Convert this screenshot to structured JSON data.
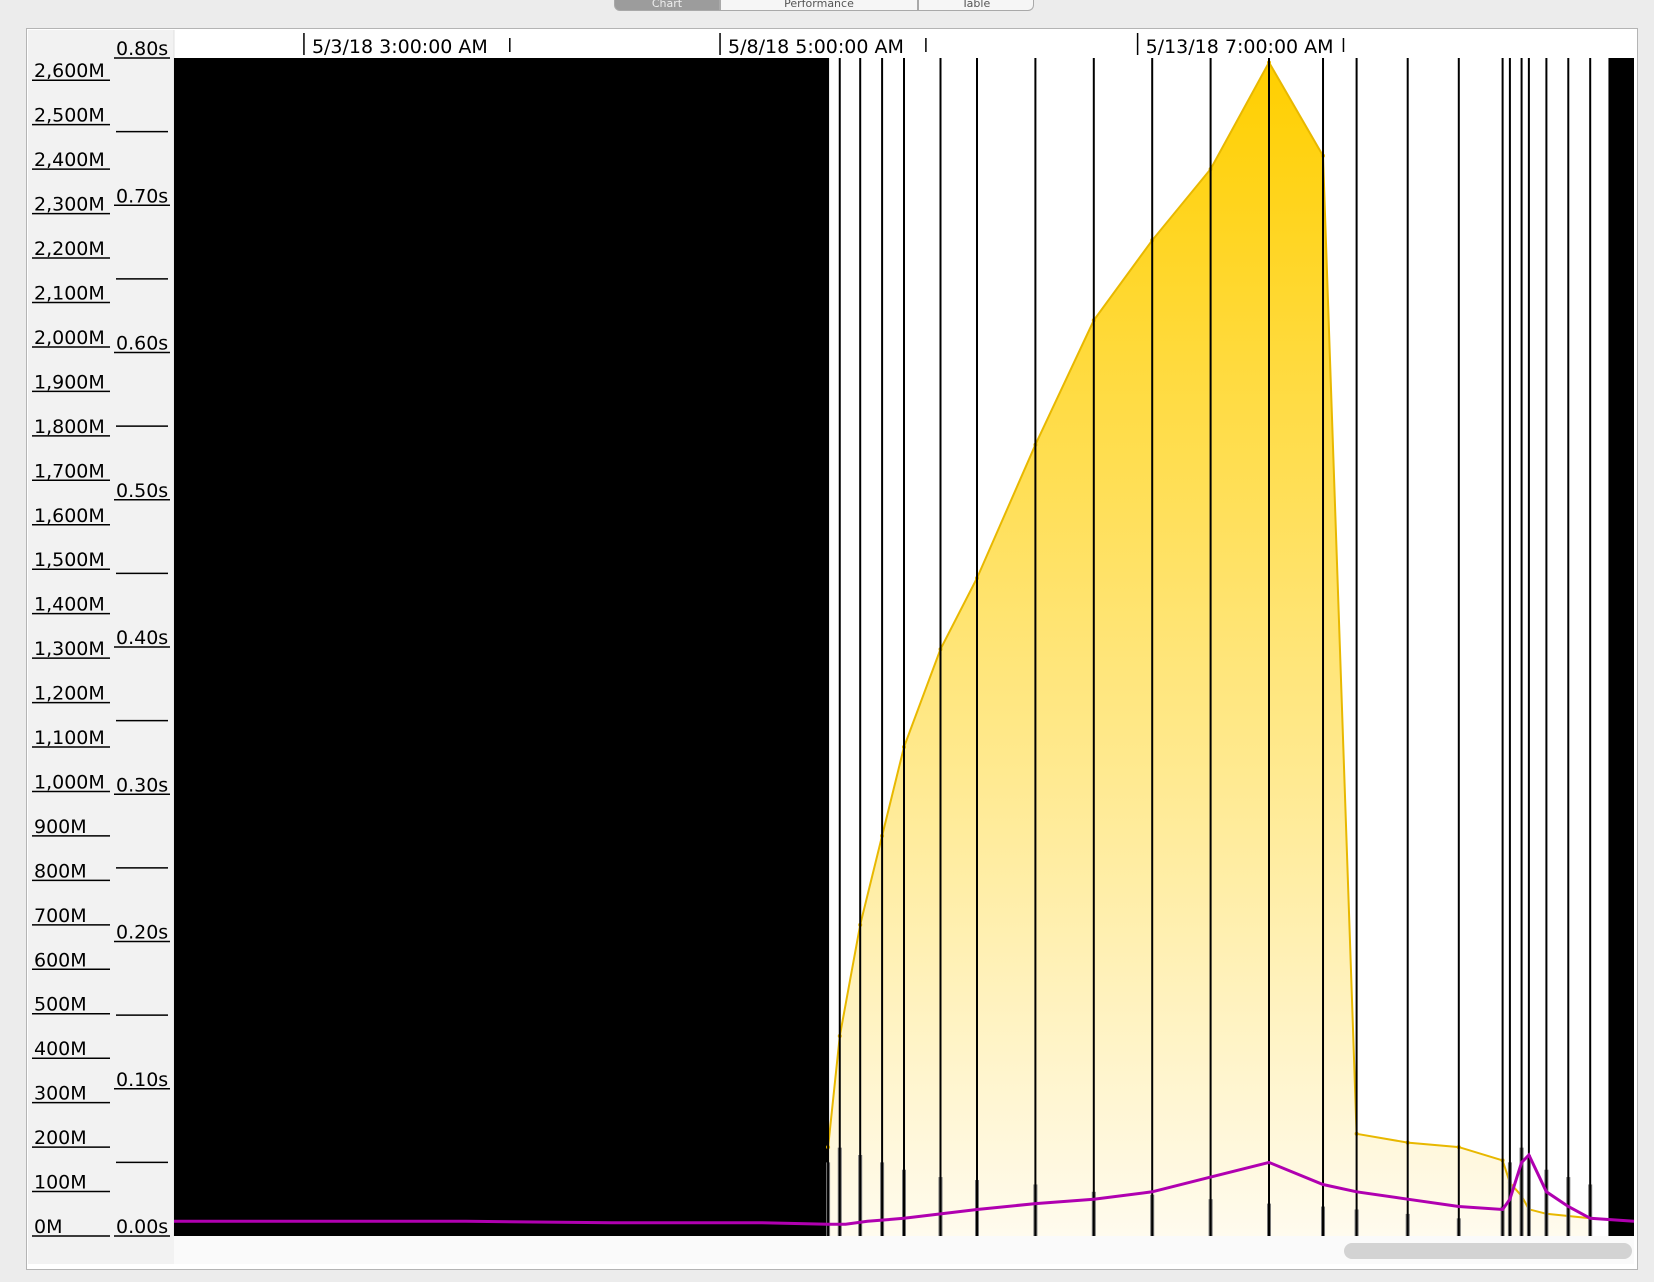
{
  "tabs": [
    {
      "label": "Chart"
    },
    {
      "label": "Performance"
    },
    {
      "label": "Table"
    }
  ],
  "chart_data": {
    "type": "area",
    "x_axis": {
      "type": "time",
      "tick_labels": [
        "5/3/18 3:00:00 AM",
        "5/8/18 5:00:00 AM",
        "5/13/18 7:00:00 AM"
      ]
    },
    "memory_axis": {
      "range": [
        0,
        2650
      ],
      "tick_labels": [
        "0M",
        "100M",
        "200M",
        "300M",
        "400M",
        "500M",
        "600M",
        "700M",
        "800M",
        "900M",
        "1,000M",
        "1,100M",
        "1,200M",
        "1,300M",
        "1,400M",
        "1,500M",
        "1,600M",
        "1,700M",
        "1,800M",
        "1,900M",
        "2,000M",
        "2,100M",
        "2,200M",
        "2,300M",
        "2,400M",
        "2,500M",
        "2,600M"
      ]
    },
    "time_axis": {
      "range": [
        0,
        0.8
      ],
      "tick_labels": [
        "0.00s",
        "0.10s",
        "0.20s",
        "0.30s",
        "0.40s",
        "0.50s",
        "0.60s",
        "0.70s",
        "0.80s"
      ]
    },
    "colors": {
      "memory_fill": "#ffcf00",
      "gc_pause": "#777777",
      "pause_line": "#b000b0",
      "no_data": "#000000",
      "gc_marker": "#000000"
    },
    "series": [
      {
        "kind": "memory",
        "x": [
          0.448,
          0.456,
          0.47,
          0.485,
          0.5,
          0.525,
          0.55,
          0.59,
          0.63,
          0.67,
          0.71,
          0.75,
          0.787,
          0.81,
          0.845,
          0.88,
          0.91,
          0.915,
          0.923,
          0.928,
          0.94,
          0.955,
          0.97
        ],
        "values": [
          200,
          450,
          700,
          900,
          1100,
          1320,
          1480,
          1780,
          2060,
          2240,
          2400,
          2640,
          2430,
          230,
          210,
          200,
          170,
          120,
          90,
          60,
          50,
          45,
          40
        ]
      },
      {
        "kind": "gc_pause",
        "x": [
          0.448,
          0.456,
          0.47,
          0.485,
          0.5,
          0.525,
          0.55,
          0.59,
          0.63,
          0.67,
          0.71,
          0.75,
          0.787,
          0.81,
          0.845,
          0.88,
          0.91,
          0.915,
          0.923,
          0.928,
          0.94,
          0.955,
          0.97
        ],
        "values": [
          0.05,
          0.06,
          0.055,
          0.05,
          0.045,
          0.04,
          0.038,
          0.035,
          0.03,
          0.028,
          0.025,
          0.022,
          0.02,
          0.018,
          0.015,
          0.012,
          0.02,
          0.05,
          0.06,
          0.055,
          0.045,
          0.04,
          0.035
        ]
      },
      {
        "kind": "pause_line",
        "x": [
          0.0,
          0.1,
          0.2,
          0.3,
          0.4,
          0.448,
          0.46,
          0.475,
          0.5,
          0.525,
          0.55,
          0.59,
          0.63,
          0.67,
          0.71,
          0.75,
          0.787,
          0.81,
          0.845,
          0.88,
          0.91,
          0.915,
          0.923,
          0.928,
          0.94,
          0.955,
          0.97,
          1.0
        ],
        "values": [
          0.01,
          0.01,
          0.01,
          0.009,
          0.009,
          0.008,
          0.008,
          0.01,
          0.012,
          0.015,
          0.018,
          0.022,
          0.025,
          0.03,
          0.04,
          0.05,
          0.035,
          0.03,
          0.025,
          0.02,
          0.018,
          0.025,
          0.05,
          0.055,
          0.03,
          0.02,
          0.012,
          0.01
        ]
      }
    ]
  }
}
